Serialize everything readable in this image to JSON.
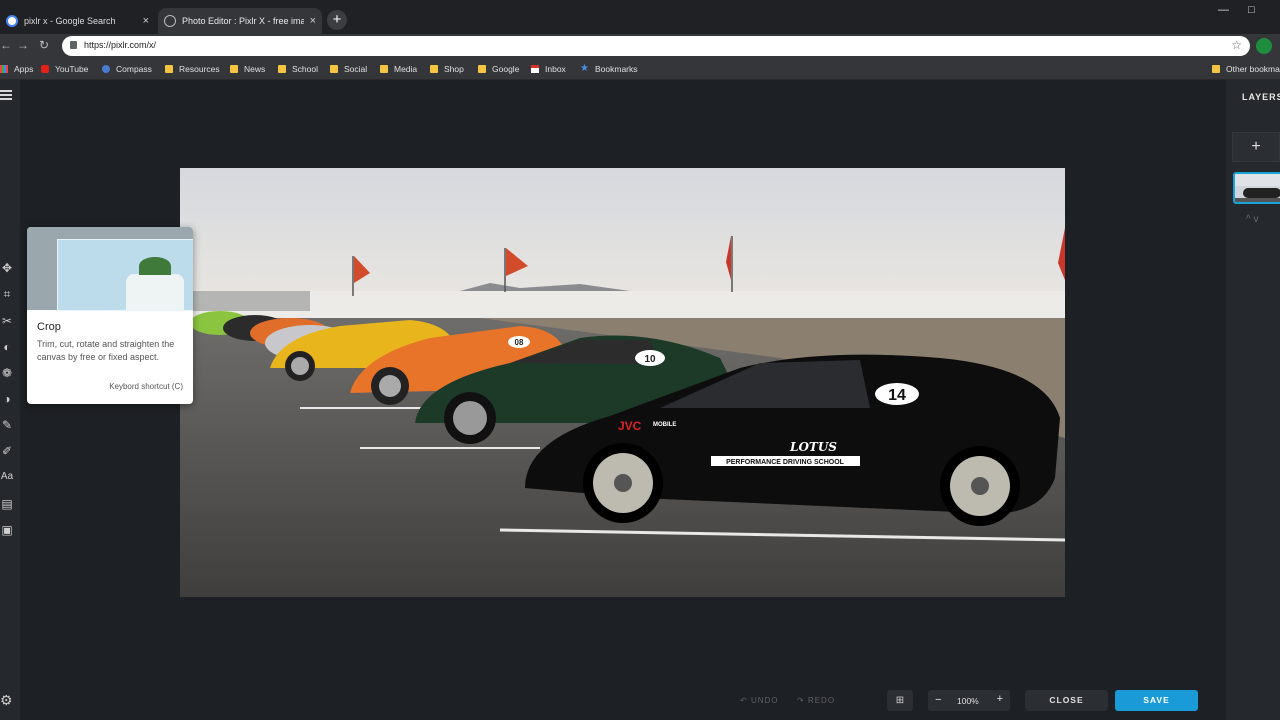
{
  "browser": {
    "tabs": [
      {
        "title": "pixlr x - Google Search",
        "close": "×"
      },
      {
        "title": "Photo Editor : Pixlr X - free image editing online",
        "close": "×"
      }
    ],
    "new_tab": "+",
    "window": {
      "minimize": "—",
      "maximize": "□"
    },
    "nav": {
      "back": "←",
      "forward": "→",
      "reload": "↻"
    },
    "url": "https://pixlr.com/x/",
    "star": "☆",
    "bookmarks": [
      {
        "label": "Apps",
        "icon": "apps-icon"
      },
      {
        "label": "YouTube",
        "icon": "youtube-icon"
      },
      {
        "label": "Compass",
        "icon": "compass-icon"
      },
      {
        "label": "Resources",
        "icon": "folder-icon"
      },
      {
        "label": "News",
        "icon": "folder-icon"
      },
      {
        "label": "School",
        "icon": "folder-icon"
      },
      {
        "label": "Social",
        "icon": "folder-icon"
      },
      {
        "label": "Media",
        "icon": "folder-icon"
      },
      {
        "label": "Shop",
        "icon": "folder-icon"
      },
      {
        "label": "Google",
        "icon": "folder-icon"
      },
      {
        "label": "Inbox",
        "icon": "gmail-icon"
      },
      {
        "label": "Bookmarks",
        "icon": "star-icon"
      },
      {
        "label": "Other bookmarks",
        "icon": "folder-icon"
      }
    ]
  },
  "editor": {
    "tooltip": {
      "title": "Crop",
      "description": "Trim, cut, rotate and straighten the canvas by free or fixed aspect.",
      "shortcut": "Keybord shortcut (C)"
    },
    "layers": {
      "title": "LAYERS",
      "add": "+",
      "arrows": "^ v"
    },
    "bottom": {
      "undo": "UNDO",
      "redo": "REDO",
      "zoom_minus": "−",
      "zoom_value": "100%",
      "zoom_plus": "+",
      "close": "CLOSE",
      "save": "SAVE"
    },
    "car_numbers": [
      "08",
      "10",
      "14"
    ],
    "car_text": {
      "brand": "LOTUS",
      "school": "PERFORMANCE DRIVING SCHOOL",
      "sponsor": "JVC",
      "sponsor_sub": "MOBILE"
    }
  },
  "colors": {
    "accent": "#1a9bd7",
    "app_bg": "#1d2024",
    "panel_bg": "#25282c"
  }
}
